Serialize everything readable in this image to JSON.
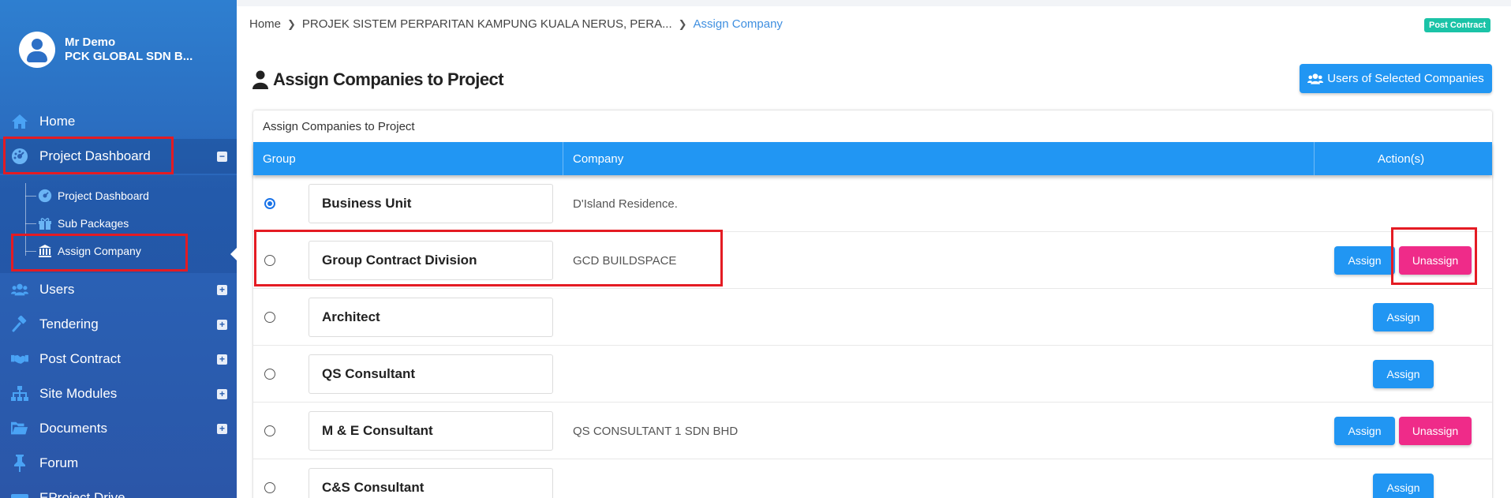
{
  "user": {
    "name": "Mr Demo",
    "company": "PCK GLOBAL SDN B..."
  },
  "sidebar": {
    "items": [
      {
        "label": "Home"
      },
      {
        "label": "Project Dashboard"
      },
      {
        "label": "Users"
      },
      {
        "label": "Tendering"
      },
      {
        "label": "Post Contract"
      },
      {
        "label": "Site Modules"
      },
      {
        "label": "Documents"
      },
      {
        "label": "Forum"
      },
      {
        "label": "EProject Drive"
      }
    ],
    "submenu": [
      {
        "label": "Project Dashboard"
      },
      {
        "label": "Sub Packages"
      },
      {
        "label": "Assign Company"
      }
    ],
    "toggle_collapse": "−",
    "toggle_expand": "+"
  },
  "breadcrumb": {
    "home": "Home",
    "project": "PROJEK SISTEM PERPARITAN KAMPUNG KUALA NERUS, PERA...",
    "current": "Assign Company"
  },
  "badge": "Post Contract",
  "page_title": "Assign Companies to Project",
  "users_button": "Users of Selected Companies",
  "panel": {
    "title": "Assign Companies to Project",
    "columns": {
      "group": "Group",
      "company": "Company",
      "actions": "Action(s)"
    },
    "assign_label": "Assign",
    "unassign_label": "Unassign",
    "rows": [
      {
        "group": "Business Unit",
        "company": "D'Island Residence.",
        "selected": true
      },
      {
        "group": "Group Contract Division",
        "company": "GCD BUILDSPACE",
        "selected": false
      },
      {
        "group": "Architect",
        "company": "",
        "selected": false
      },
      {
        "group": "QS Consultant",
        "company": "",
        "selected": false
      },
      {
        "group": "M & E Consultant",
        "company": "QS CONSULTANT 1 SDN BHD",
        "selected": false
      },
      {
        "group": "C&S Consultant",
        "company": "",
        "selected": false
      }
    ]
  },
  "colors": {
    "sidebar": "#2b64b8",
    "primary": "#2196f3",
    "danger": "#ef2b89",
    "badge": "#1bc3a7",
    "highlight": "#e41b23"
  }
}
